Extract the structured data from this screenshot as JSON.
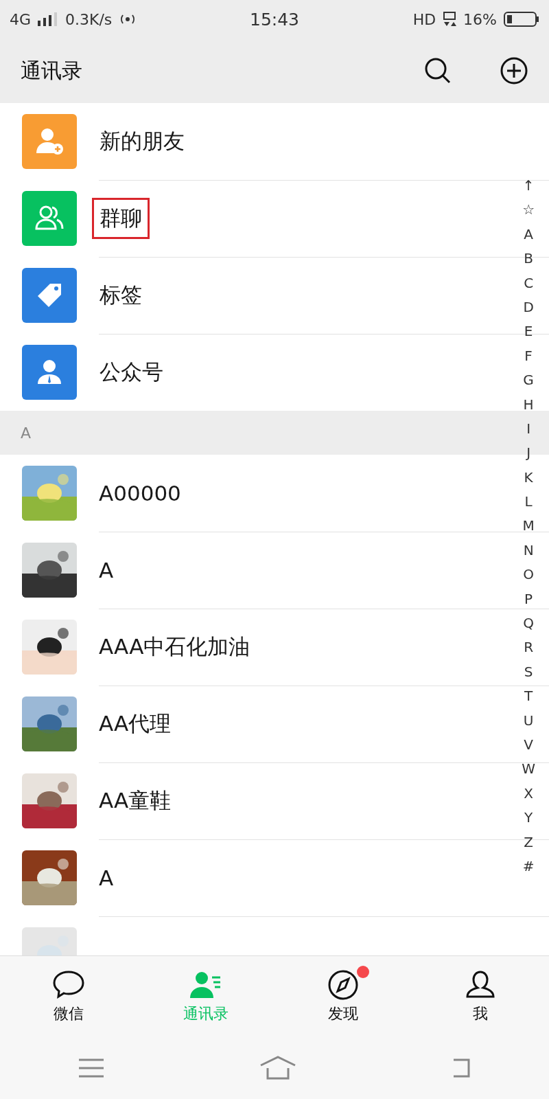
{
  "status_bar": {
    "network": "4G",
    "speed": "0.3K/s",
    "time": "15:43",
    "hd": "HD",
    "battery": "16%"
  },
  "header": {
    "title": "通讯录"
  },
  "functions": [
    {
      "kind": "new_friends",
      "label": "新的朋友",
      "highlighted": false
    },
    {
      "kind": "group_chats",
      "label": "群聊",
      "highlighted": true
    },
    {
      "kind": "tags",
      "label": "标签",
      "highlighted": false
    },
    {
      "kind": "official_accounts",
      "label": "公众号",
      "highlighted": false
    }
  ],
  "section": {
    "letter": "A"
  },
  "contacts": [
    {
      "name": "A00000"
    },
    {
      "name": "A"
    },
    {
      "name": "AAA中石化加油"
    },
    {
      "name": "AA代理"
    },
    {
      "name": "AA童鞋"
    },
    {
      "name": "A"
    }
  ],
  "index": [
    "↑",
    "☆",
    "A",
    "B",
    "C",
    "D",
    "E",
    "F",
    "G",
    "H",
    "I",
    "J",
    "K",
    "L",
    "M",
    "N",
    "O",
    "P",
    "Q",
    "R",
    "S",
    "T",
    "U",
    "V",
    "W",
    "X",
    "Y",
    "Z",
    "#"
  ],
  "tabs": [
    {
      "kind": "chats",
      "label": "微信",
      "selected": false,
      "badge": false
    },
    {
      "kind": "contacts",
      "label": "通讯录",
      "selected": true,
      "badge": false
    },
    {
      "kind": "discover",
      "label": "发现",
      "selected": false,
      "badge": true
    },
    {
      "kind": "me",
      "label": "我",
      "selected": false,
      "badge": false
    }
  ]
}
